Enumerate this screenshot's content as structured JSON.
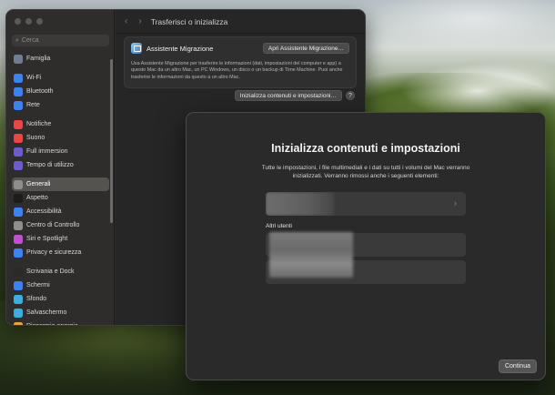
{
  "settings": {
    "search_placeholder": "Cerca",
    "toolbar_title": "Trasferisci o inizializza",
    "sidebar": [
      {
        "label": "Famiglia",
        "icon": "family-icon",
        "color": "#6f7e95"
      },
      {
        "gap": true
      },
      {
        "label": "Wi-Fi",
        "icon": "wifi-icon",
        "color": "#3b82f6"
      },
      {
        "label": "Bluetooth",
        "icon": "bluetooth-icon",
        "color": "#3b82f6"
      },
      {
        "label": "Rete",
        "icon": "network-icon",
        "color": "#3b82f6"
      },
      {
        "gap": true
      },
      {
        "label": "Notifiche",
        "icon": "notifications-icon",
        "color": "#ef4444"
      },
      {
        "label": "Suono",
        "icon": "sound-icon",
        "color": "#ef4444"
      },
      {
        "label": "Full immersion",
        "icon": "focus-icon",
        "color": "#6d5bd0"
      },
      {
        "label": "Tempo di utilizzo",
        "icon": "screen-time-icon",
        "color": "#6d5bd0"
      },
      {
        "gap": true
      },
      {
        "label": "Generali",
        "icon": "gear-icon",
        "color": "#8e8e8e",
        "selected": true
      },
      {
        "label": "Aspetto",
        "icon": "appearance-icon",
        "color": "#1c1c1c"
      },
      {
        "label": "Accessibilità",
        "icon": "accessibility-icon",
        "color": "#3b82f6"
      },
      {
        "label": "Centro di Controllo",
        "icon": "control-center-icon",
        "color": "#8e8e8e"
      },
      {
        "label": "Siri e Spotlight",
        "icon": "siri-icon",
        "color": "#c24ed6"
      },
      {
        "label": "Privacy e sicurezza",
        "icon": "hand-icon",
        "color": "#3b82f6"
      },
      {
        "gap": true
      },
      {
        "label": "Scrivania e Dock",
        "icon": "dock-icon",
        "color": "#2a2a2a"
      },
      {
        "label": "Schermi",
        "icon": "display-icon",
        "color": "#3b82f6"
      },
      {
        "label": "Sfondo",
        "icon": "wallpaper-icon",
        "color": "#3bb0e0"
      },
      {
        "label": "Salvaschermo",
        "icon": "screensaver-icon",
        "color": "#3bb0e0"
      },
      {
        "label": "Risparmio energia",
        "icon": "battery-icon",
        "color": "#e8a33a"
      }
    ],
    "migration": {
      "title": "Assistente Migrazione",
      "button": "Apri Assistente Migrazione…",
      "description": "Usa Assistente Migrazione per trasferire le informazioni (dati, impostazioni del computer e app) a questo Mac da un altro Mac, un PC Windows, un disco o un backup di Time Machine. Puoi anche trasferire le informazioni da questo a un altro Mac."
    },
    "reset_button": "Inizializza contenuti e impostazioni…",
    "help": "?"
  },
  "dialog": {
    "title": "Inizializza contenuti e impostazioni",
    "description": "Tutte le impostazioni, i file multimediali e i dati su tutti i volumi del Mac verranno inizializzati. Verranno rimossi anche i seguenti elementi:",
    "other_users_label": "Altri utenti",
    "continue_button": "Continua"
  }
}
